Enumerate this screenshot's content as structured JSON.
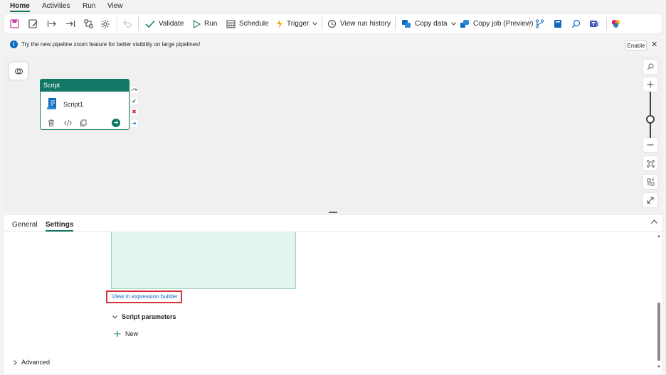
{
  "tabs": [
    {
      "label": "Home",
      "active": true
    },
    {
      "label": "Activities"
    },
    {
      "label": "Run"
    },
    {
      "label": "View"
    }
  ],
  "toolbar": {
    "validate": "Validate",
    "run": "Run",
    "schedule": "Schedule",
    "trigger": "Trigger",
    "view_run_history": "View run history",
    "copy_data": "Copy data",
    "copy_job": "Copy job (Preview)",
    "icons": [
      "save-icon",
      "save-as-icon",
      "move-right-icon",
      "move-to-end-icon",
      "auto-align-icon",
      "settings-gear-icon",
      "undo-icon",
      "branch-icon",
      "notebook-icon",
      "search-icon",
      "teams-icon",
      "copilot-icon"
    ]
  },
  "infobar": {
    "text": "Try the new pipeline zoom feature for better visibility on large pipelines!",
    "enable_label": "Enable"
  },
  "canvas": {
    "activity": {
      "type_label": "Script",
      "name": "Script1"
    },
    "zoom_level": 0.6
  },
  "panel": {
    "tabs": [
      {
        "label": "General"
      },
      {
        "label": "Settings",
        "active": true
      }
    ],
    "expression_builder_link": "View in expression builder",
    "script_parameters_label": "Script parameters",
    "new_label": "New",
    "advanced_label": "Advanced"
  },
  "colors": {
    "accent": "#117865",
    "link": "#0f6cbd",
    "highlight_border": "#d13438"
  }
}
